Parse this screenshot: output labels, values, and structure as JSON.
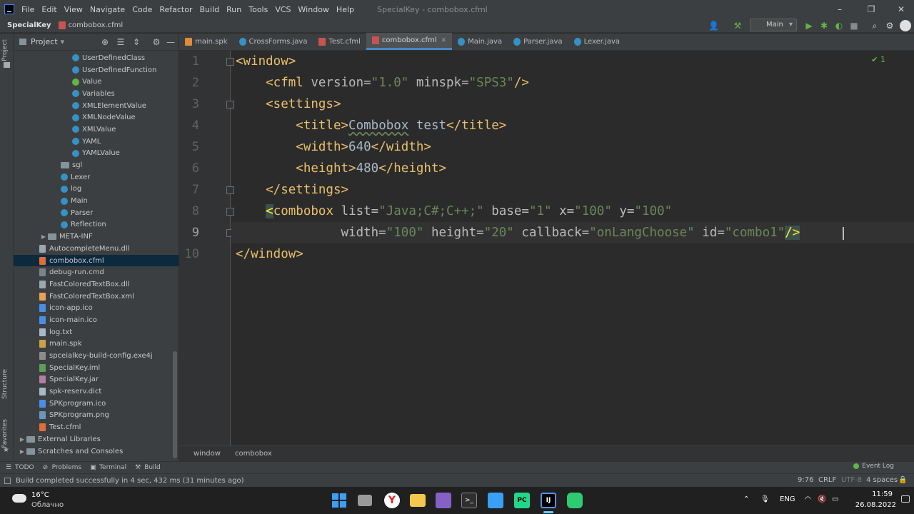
{
  "titlebar": {
    "menu": [
      "File",
      "Edit",
      "View",
      "Navigate",
      "Code",
      "Refactor",
      "Build",
      "Run",
      "Tools",
      "VCS",
      "Window",
      "Help"
    ],
    "window_title": "SpecialKey - combobox.cfml"
  },
  "navbar": {
    "project": "SpecialKey",
    "file": "combobox.cfml",
    "run_config": "Main"
  },
  "project_panel": {
    "title": "Project",
    "tree": [
      {
        "label": "UserDefinedClass",
        "icon": "class",
        "indent": 82
      },
      {
        "label": "UserDefinedFunction",
        "icon": "class",
        "indent": 82
      },
      {
        "label": "Value",
        "icon": "interface",
        "indent": 82
      },
      {
        "label": "Variables",
        "icon": "class",
        "indent": 82
      },
      {
        "label": "XMLElementValue",
        "icon": "class",
        "indent": 82
      },
      {
        "label": "XMLNodeValue",
        "icon": "class",
        "indent": 82
      },
      {
        "label": "XMLValue",
        "icon": "class",
        "indent": 82
      },
      {
        "label": "YAML",
        "icon": "class",
        "indent": 82
      },
      {
        "label": "YAMLValue",
        "icon": "class",
        "indent": 82
      },
      {
        "label": "sgl",
        "icon": "folder",
        "indent": 66
      },
      {
        "label": "Lexer",
        "icon": "class",
        "indent": 66
      },
      {
        "label": "log",
        "icon": "class",
        "indent": 66
      },
      {
        "label": "Main",
        "icon": "class",
        "indent": 66
      },
      {
        "label": "Parser",
        "icon": "class",
        "indent": 66
      },
      {
        "label": "Reflection",
        "icon": "class",
        "indent": 66
      },
      {
        "label": "META-INF",
        "icon": "folder",
        "indent": 36,
        "arrow": true
      },
      {
        "label": "AutocompleteMenu.dll",
        "icon": "f-dll",
        "indent": 36
      },
      {
        "label": "combobox.cfml",
        "icon": "f-cfml",
        "indent": 36,
        "selected": true
      },
      {
        "label": "debug-run.cmd",
        "icon": "f-cmd",
        "indent": 36
      },
      {
        "label": "FastColoredTextBox.dll",
        "icon": "f-dll",
        "indent": 36
      },
      {
        "label": "FastColoredTextBox.xml",
        "icon": "f-xml",
        "indent": 36
      },
      {
        "label": "icon-app.ico",
        "icon": "f-ico",
        "indent": 36
      },
      {
        "label": "icon-main.ico",
        "icon": "f-ico",
        "indent": 36
      },
      {
        "label": "log.txt",
        "icon": "f-txt",
        "indent": 36
      },
      {
        "label": "main.spk",
        "icon": "f-spk",
        "indent": 36
      },
      {
        "label": "spceialkey-build-config.exe4j",
        "icon": "f-exe",
        "indent": 36
      },
      {
        "label": "SpecialKey.iml",
        "icon": "f-iml",
        "indent": 36
      },
      {
        "label": "SpecialKey.jar",
        "icon": "f-jar",
        "indent": 36
      },
      {
        "label": "spk-reserv.dict",
        "icon": "f-txt",
        "indent": 36
      },
      {
        "label": "SPKprogram.ico",
        "icon": "f-ico",
        "indent": 36
      },
      {
        "label": "SPKprogram.png",
        "icon": "f-png",
        "indent": 36
      },
      {
        "label": "Test.cfml",
        "icon": "f-cfml",
        "indent": 36
      },
      {
        "label": "External Libraries",
        "icon": "folder",
        "indent": 6,
        "arrow": true
      },
      {
        "label": "Scratches and Consoles",
        "icon": "folder",
        "indent": 6,
        "arrow": true
      }
    ]
  },
  "left_strip": {
    "project_label": "Project",
    "structure_label": "Structure",
    "favorites_label": "Favorites"
  },
  "editor_tabs": [
    {
      "label": "main.spk",
      "icon": "orange"
    },
    {
      "label": "CrossForms.java",
      "icon": "blue"
    },
    {
      "label": "Test.cfml",
      "icon": "red"
    },
    {
      "label": "combobox.cfml",
      "icon": "red",
      "active": true
    },
    {
      "label": "Main.java",
      "icon": "blue"
    },
    {
      "label": "Parser.java",
      "icon": "blue"
    },
    {
      "label": "Lexer.java",
      "icon": "blue"
    }
  ],
  "editor": {
    "inspection_count": "1",
    "line_numbers": [
      "1",
      "2",
      "3",
      "4",
      "5",
      "6",
      "7",
      "8",
      "9",
      "10"
    ],
    "current_line": 9,
    "lines": [
      [
        {
          "c": "tag",
          "t": "<window>"
        }
      ],
      [
        {
          "c": "tag",
          "t": "    <cfml "
        },
        {
          "c": "attr",
          "t": "version="
        },
        {
          "c": "str",
          "t": "\"1.0\""
        },
        {
          "c": "attr",
          "t": " minspk="
        },
        {
          "c": "str",
          "t": "\"SPS3\""
        },
        {
          "c": "tag",
          "t": "/>"
        }
      ],
      [
        {
          "c": "tag",
          "t": "    <settings>"
        }
      ],
      [
        {
          "c": "tag",
          "t": "        <title>"
        },
        {
          "c": "txt typo",
          "t": "Combobox"
        },
        {
          "c": "txt",
          "t": " test"
        },
        {
          "c": "tag",
          "t": "</title>"
        }
      ],
      [
        {
          "c": "tag",
          "t": "        <width>"
        },
        {
          "c": "txt",
          "t": "640"
        },
        {
          "c": "tag",
          "t": "</width>"
        }
      ],
      [
        {
          "c": "tag",
          "t": "        <height>"
        },
        {
          "c": "txt",
          "t": "480"
        },
        {
          "c": "tag",
          "t": "</height>"
        }
      ],
      [
        {
          "c": "tag",
          "t": "    </settings>"
        }
      ],
      [
        {
          "c": "tag",
          "t": "    "
        },
        {
          "c": "tag match",
          "t": "<"
        },
        {
          "c": "tag",
          "t": "combobox "
        },
        {
          "c": "attr",
          "t": "list="
        },
        {
          "c": "str",
          "t": "\"Java;C#;C++;\""
        },
        {
          "c": "attr",
          "t": " base="
        },
        {
          "c": "str",
          "t": "\"1\""
        },
        {
          "c": "attr",
          "t": " x="
        },
        {
          "c": "str",
          "t": "\"100\""
        },
        {
          "c": "attr",
          "t": " y="
        },
        {
          "c": "str",
          "t": "\"100\""
        }
      ],
      [
        {
          "c": "attr",
          "t": "              width="
        },
        {
          "c": "str",
          "t": "\"100\""
        },
        {
          "c": "attr",
          "t": " height="
        },
        {
          "c": "str",
          "t": "\"20\""
        },
        {
          "c": "attr",
          "t": " callback="
        },
        {
          "c": "str",
          "t": "\"onLangChoose\""
        },
        {
          "c": "attr",
          "t": " id="
        },
        {
          "c": "str",
          "t": "\"combo1\""
        },
        {
          "c": "tag match",
          "t": "/>"
        }
      ],
      [
        {
          "c": "tag",
          "t": "</window>"
        }
      ]
    ]
  },
  "editor_crumbs": [
    "window",
    "combobox"
  ],
  "tool_tabs": [
    "TODO",
    "Problems",
    "Terminal",
    "Build"
  ],
  "event_log": "Event Log",
  "status": {
    "message": "Build completed successfully in 4 sec, 432 ms (31 minutes ago)",
    "position": "9:76",
    "line_sep": "CRLF",
    "encoding": "UTF-8",
    "indent": "4 spaces"
  },
  "taskbar": {
    "temperature": "16°C",
    "weather": "Облачно",
    "lang": "ENG",
    "time": "11:59",
    "date": "26.08.2022"
  }
}
